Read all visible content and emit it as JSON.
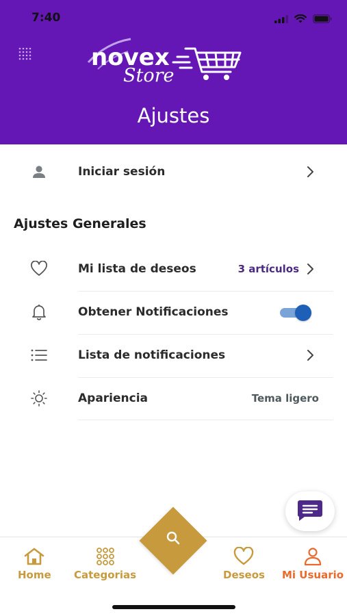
{
  "status_bar": {
    "time": "7:40"
  },
  "header": {
    "title": "Ajustes",
    "logo_main": "novex",
    "logo_sub": "Store"
  },
  "login_row": {
    "label": "Iniciar sesión"
  },
  "general": {
    "section_title": "Ajustes Generales",
    "wishlist": {
      "label": "Mi lista de deseos",
      "value": "3 artículos"
    },
    "notifications": {
      "label": "Obtener Notificaciones",
      "enabled": true
    },
    "notifications_list": {
      "label": "Lista de notificaciones"
    },
    "appearance": {
      "label": "Apariencia",
      "value": "Tema ligero"
    }
  },
  "bottom_nav": {
    "home": "Home",
    "categories": "Categorias",
    "wishes": "Deseos",
    "user": "Mi Usuario"
  },
  "colors": {
    "brand_purple": "#6417b4",
    "gold": "#c89a3e",
    "active_orange": "#e86a2c",
    "toggle_blue": "#1e5fb8",
    "value_purple": "#4a2a80",
    "value_gray": "#4f5a5c"
  }
}
